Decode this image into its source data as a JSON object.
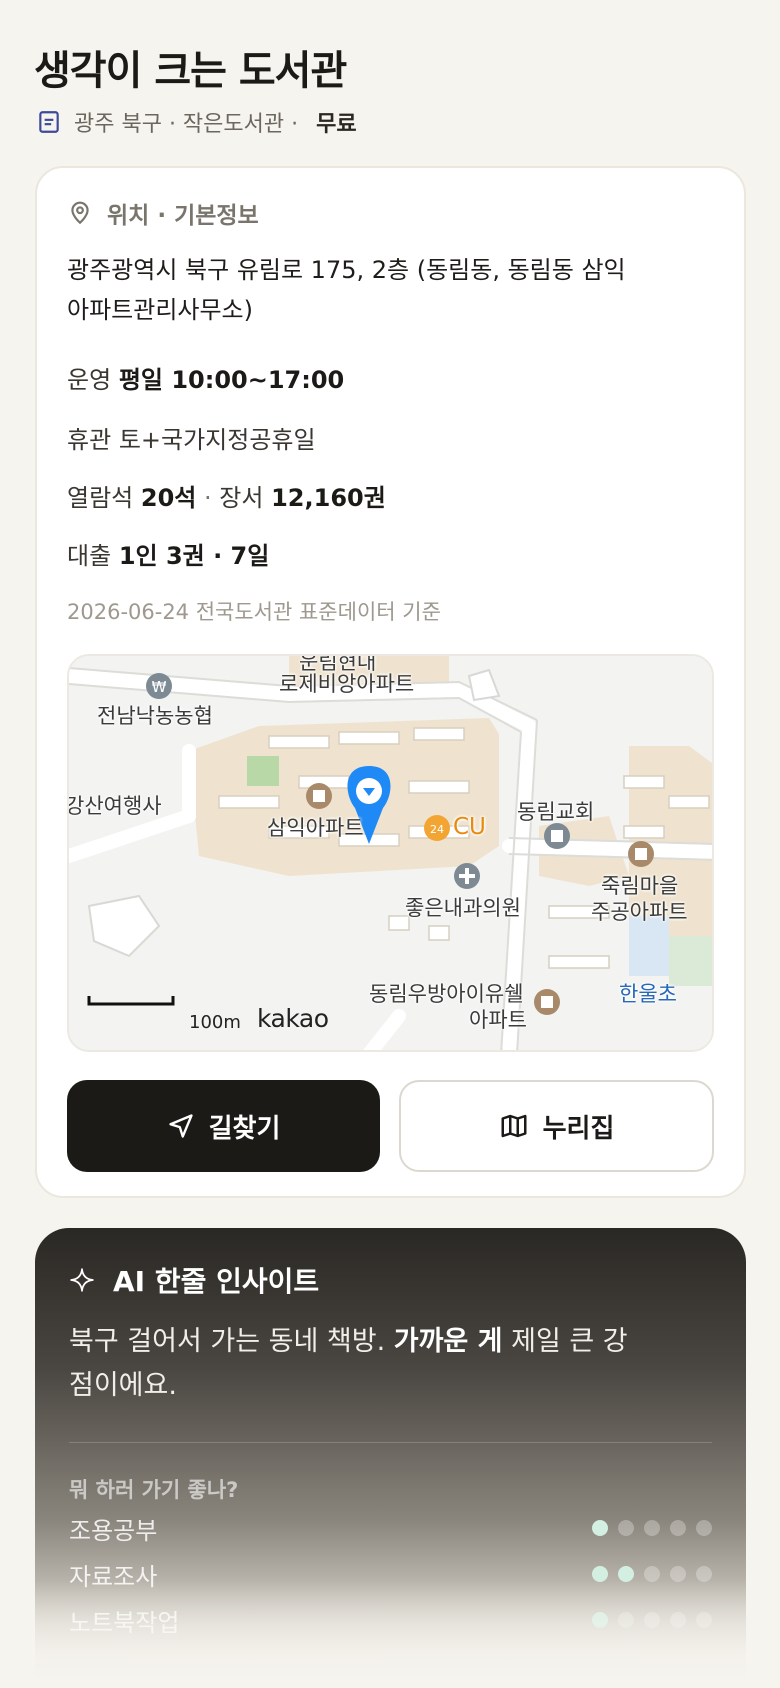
{
  "header": {
    "title": "생각이 크는 도서관",
    "meta": "광주 북구 · 작은도서관 · ",
    "fee": "무료"
  },
  "info": {
    "section_title": "위치 · 기본정보",
    "address": "광주광역시 북구 유림로 175, 2층 (동림동, 동림동 삼익아파트관리사무소)",
    "hours_label": "운영",
    "hours_value": "평일 10:00~17:00",
    "closed_label": "휴관",
    "closed_value": "토+국가지정공휴일",
    "seats_label": "열람석",
    "seats_value": "20석",
    "books_label": "장서",
    "books_value": "12,160권",
    "loan_label": "대출",
    "loan_value": "1인 3권 · 7일",
    "data_note": "2026-06-24 전국도서관 표준데이터 기준"
  },
  "map": {
    "labels": {
      "top_apt_1": "운림현대",
      "top_apt_2": "로제비앙아파트",
      "bank": "전남낙농농협",
      "travel": "강산여행사",
      "samik": "삼익아파트",
      "cu": "CU",
      "church": "동림교회",
      "jukrim_1": "죽림마을",
      "jukrim_2": "주공아파트",
      "clinic": "좋은내과의원",
      "woobang_1": "동림우방아이유쉘",
      "woobang_2": "아파트",
      "hanul": "한울초"
    },
    "scale": "100m",
    "provider": "kakao",
    "pin_color": "#1f8af5"
  },
  "actions": {
    "directions": "길찾기",
    "nurijip": "누리집"
  },
  "ai": {
    "title": "AI 한줄 인사이트",
    "text_pre": "북구 걸어서 가는 동네 책방. ",
    "text_bold": "가까운 게",
    "text_post": " 제일 큰 강점이에요.",
    "question": "뭐 하러 가기 좋나?",
    "ratings": [
      {
        "label": "조용공부",
        "score": 1,
        "max": 5
      },
      {
        "label": "자료조사",
        "score": 2,
        "max": 5
      },
      {
        "label": "노트북작업",
        "score": 1,
        "max": 5
      }
    ],
    "dot_on_color": "#d3efe2"
  }
}
